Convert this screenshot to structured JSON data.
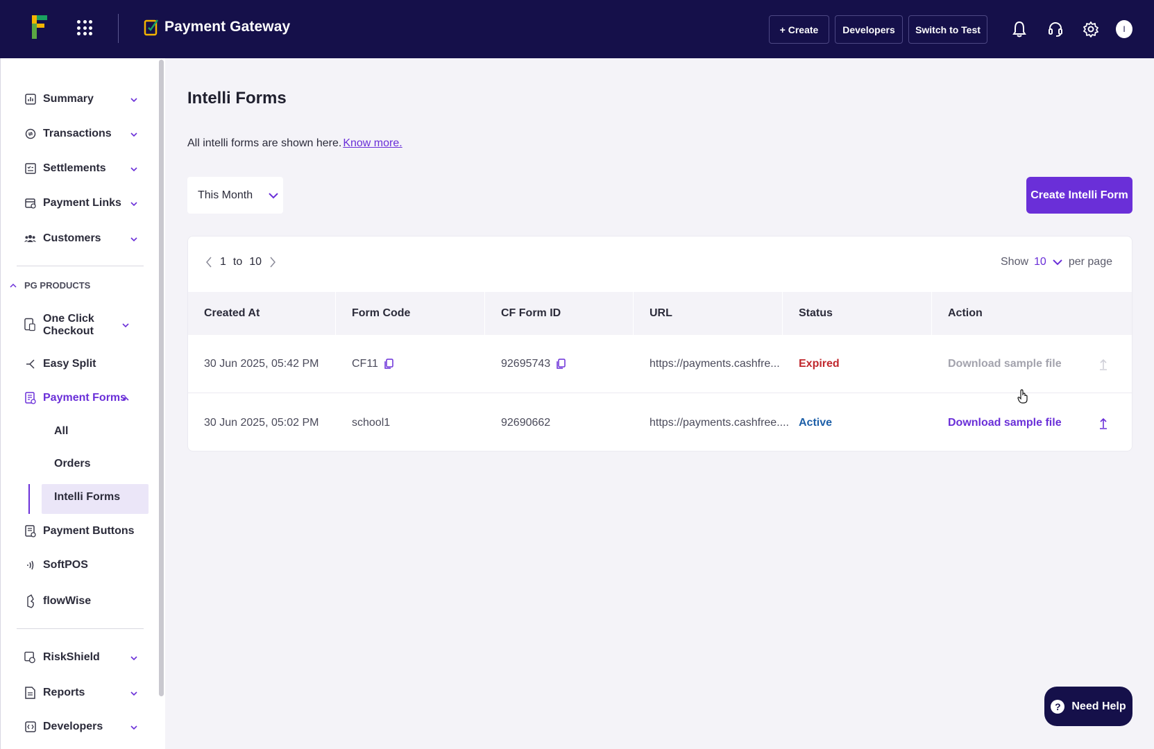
{
  "topbar": {
    "app_title": "Payment Gateway",
    "create_label": "+ Create",
    "developers_label": "Developers",
    "switch_label": "Switch to Test",
    "avatar_initial": "I",
    "icons": [
      "apps-grid-icon",
      "bell-icon",
      "headset-icon",
      "gear-icon"
    ]
  },
  "sidebar": {
    "items": [
      {
        "label": "Summary",
        "icon": "chart-icon"
      },
      {
        "label": "Transactions",
        "icon": "transactions-icon"
      },
      {
        "label": "Settlements",
        "icon": "settlements-icon"
      },
      {
        "label": "Payment Links",
        "icon": "payment-links-icon"
      },
      {
        "label": "Customers",
        "icon": "customers-icon"
      }
    ],
    "section_label": "PG PRODUCTS",
    "products": [
      {
        "label": "One Click Checkout"
      },
      {
        "label": "Easy Split"
      },
      {
        "label": "Payment Forms"
      },
      {
        "label": "Payment Buttons"
      },
      {
        "label": "SoftPOS"
      },
      {
        "label": "flowWise"
      }
    ],
    "payment_forms_sub": [
      "All",
      "Orders",
      "Intelli Forms"
    ],
    "bottom": [
      {
        "label": "RiskShield"
      },
      {
        "label": "Reports"
      },
      {
        "label": "Developers"
      }
    ]
  },
  "main": {
    "title": "Intelli Forms",
    "subtitle": "All intelli forms are shown here.",
    "know_more": "Know more.",
    "filter_value": "This Month",
    "create_button": "Create Intelli Form",
    "pager": {
      "from": "1",
      "to_word": "to",
      "to": "10"
    },
    "per_page": {
      "show": "Show",
      "value": "10",
      "suffix": "per page"
    },
    "columns": [
      "Created At",
      "Form Code",
      "CF Form ID",
      "URL",
      "Status",
      "Action"
    ],
    "rows": [
      {
        "created_at": "30 Jun 2025, 05:42 PM",
        "form_code": "CF11",
        "cf_form_id": "92695743",
        "url": "https://payments.cashfre...",
        "status": "Expired",
        "action": "Download sample file"
      },
      {
        "created_at": "30 Jun 2025, 05:02 PM",
        "form_code": "school1",
        "cf_form_id": "92690662",
        "url": "https://payments.cashfree....",
        "status": "Active",
        "action": "Download sample file"
      }
    ]
  },
  "help": {
    "label": "Need Help"
  },
  "colors": {
    "topbar": "#15104a",
    "accent": "#6a2fd8",
    "expired": "#c0272d",
    "active": "#1d5fa8"
  }
}
